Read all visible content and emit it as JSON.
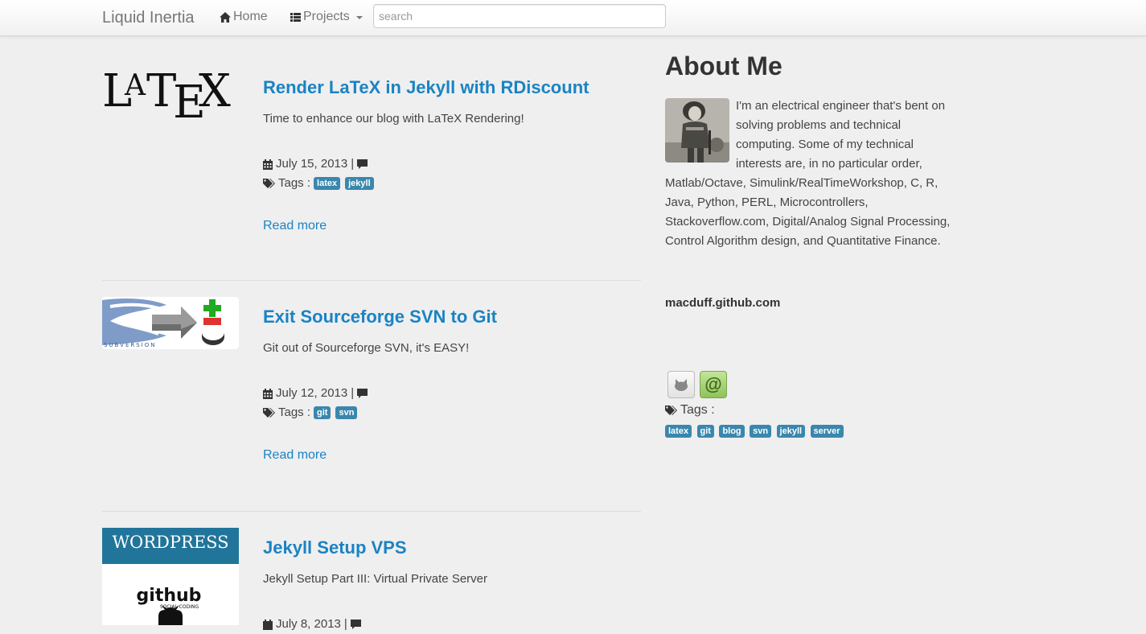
{
  "nav": {
    "brand": "Liquid Inertia",
    "home_label": "Home",
    "projects_label": "Projects",
    "search_placeholder": "search"
  },
  "posts": [
    {
      "title": "Render LaTeX in Jekyll with RDiscount",
      "description": "Time to enhance our blog with LaTeX Rendering!",
      "date": "July 15, 2013",
      "separator": "|",
      "tags_label": "Tags :",
      "tags": [
        "latex",
        "jekyll"
      ],
      "read_more": "Read more",
      "thumb_text": "LATEX"
    },
    {
      "title": "Exit Sourceforge SVN to Git",
      "description": "Git out of Sourceforge SVN, it's EASY!",
      "date": "July 12, 2013",
      "separator": "|",
      "tags_label": "Tags :",
      "tags": [
        "git",
        "svn"
      ],
      "read_more": "Read more",
      "thumb_text": "SUBVERSION"
    },
    {
      "title": "Jekyll Setup VPS",
      "description": "Jekyll Setup Part III: Virtual Private Server",
      "date": "July 8, 2013",
      "separator": "|",
      "thumb_text": "WORDPRESS",
      "thumb_text2": "github",
      "thumb_text3": "SOCIAL CODING"
    }
  ],
  "sidebar": {
    "title": "About Me",
    "bio": "I'm an electrical engineer that's bent on solving problems and technical computing. Some of my technical interests are, in no particular order, Matlab/Octave, Simulink/RealTimeWorkshop, C, R, Java, Python, PERL, Microcontrollers, Stackoverflow.com, Digital/Analog Signal Processing, Control Algorithm design, and Quantitative Finance.",
    "site": "macduff.github.com",
    "mail_glyph": "@",
    "tags_label": "Tags :",
    "tags": [
      "latex",
      "git",
      "blog",
      "svn",
      "jekyll",
      "server"
    ]
  },
  "colors": {
    "link": "#1a83c4",
    "tag": "#3a87ad",
    "background": "#efefef"
  }
}
